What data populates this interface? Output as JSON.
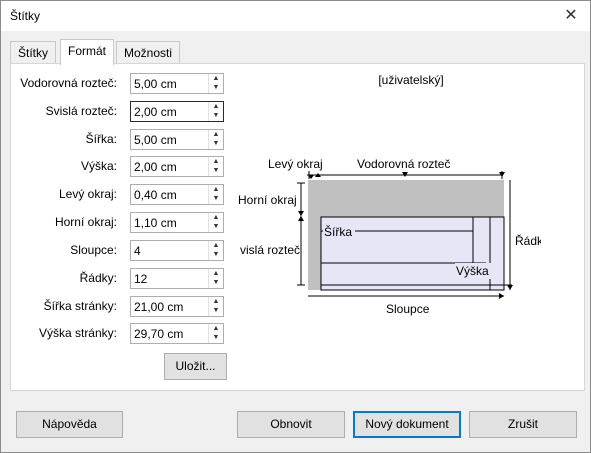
{
  "window": {
    "title": "Štítky"
  },
  "tabs": [
    "Štítky",
    "Formát",
    "Možnosti"
  ],
  "fields": [
    {
      "label": "Vodorovná rozteč:",
      "value": "5,00 cm"
    },
    {
      "label": "Svislá rozteč:",
      "value": "2,00 cm"
    },
    {
      "label": "Šířka:",
      "value": "5,00 cm"
    },
    {
      "label": "Výška:",
      "value": "2,00 cm"
    },
    {
      "label": "Levý okraj:",
      "value": "0,40 cm"
    },
    {
      "label": "Horní okraj:",
      "value": "1,10 cm"
    },
    {
      "label": "Sloupce:",
      "value": "4"
    },
    {
      "label": "Řádky:",
      "value": "12"
    },
    {
      "label": "Šířka stránky:",
      "value": "21,00 cm"
    },
    {
      "label": "Výška stránky:",
      "value": "29,70 cm"
    }
  ],
  "save_button": "Uložit...",
  "preview": {
    "format_name": "[uživatelský]",
    "left_margin": "Levý okraj",
    "horizontal_pitch": "Vodorovná rozteč",
    "top_margin": "Horní okraj",
    "vertical_pitch": "vislá rozteč",
    "width": "Šířka",
    "height": "Výška",
    "rows": "Řádky",
    "columns": "Sloupce"
  },
  "buttons": {
    "help": "Nápověda",
    "reset": "Obnovit",
    "new_document": "Nový dokument",
    "cancel": "Zrušit"
  },
  "colors": {
    "accent": "#0078d7",
    "label_fill": "#e6e6f6",
    "margin_fill": "#c0c0c0"
  }
}
